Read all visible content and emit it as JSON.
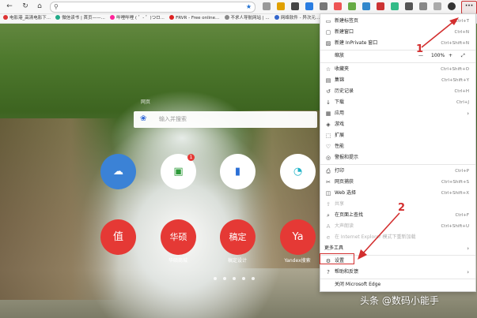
{
  "toolbar": {
    "back_icon": "back-arrow-icon",
    "refresh_icon": "refresh-icon",
    "home_icon": "home-icon",
    "more_label": "···"
  },
  "favorites": [
    {
      "label": "电影港_高清电影下...",
      "color": "#d33"
    },
    {
      "label": "微信读书 | 首页——...",
      "color": "#2a8"
    },
    {
      "label": "哔哩哔哩 ( ゜- ゜)つロ...",
      "color": "#f29"
    },
    {
      "label": "FRVR - Free online...",
      "color": "#d22"
    },
    {
      "label": "不求人导航网站 | ...",
      "color": "#888"
    },
    {
      "label": "网络软件 - 异次元...",
      "color": "#36c"
    }
  ],
  "search": {
    "tab_label": "网页",
    "placeholder": "输入并搜索"
  },
  "tiles": [
    {
      "symbol": "☁",
      "label": "",
      "color": "#3b82d6"
    },
    {
      "symbol": "▣",
      "label": "",
      "color": "#ffffff",
      "badge": "1"
    },
    {
      "symbol": "▮",
      "label": "",
      "color": "#ffffff"
    },
    {
      "symbol": "◔",
      "label": "",
      "color": "#ffffff"
    },
    {
      "symbol": "值",
      "label": "",
      "color": "#e53935"
    },
    {
      "symbol": "华硕",
      "label": "华硕商城",
      "color": "#e53935"
    },
    {
      "symbol": "稿定",
      "label": "稿定设计",
      "color": "#e53935"
    },
    {
      "symbol": "Ya",
      "label": "Yandex搜索",
      "color": "#e53935"
    }
  ],
  "menu": {
    "items": [
      {
        "icon": "▭",
        "label": "新建标签页",
        "shortcut": "Ctrl+T"
      },
      {
        "icon": "▢",
        "label": "新建窗口",
        "shortcut": "Ctrl+N"
      },
      {
        "icon": "▨",
        "label": "新建 InPrivate 窗口",
        "shortcut": "Ctrl+Shift+N"
      },
      {
        "icon": "",
        "label": "缩放",
        "shortcut": ""
      },
      {
        "icon": "☆",
        "label": "收藏夹",
        "shortcut": "Ctrl+Shift+O"
      },
      {
        "icon": "▤",
        "label": "集锦",
        "shortcut": "Ctrl+Shift+Y"
      },
      {
        "icon": "↺",
        "label": "历史记录",
        "shortcut": "Ctrl+H"
      },
      {
        "icon": "↓",
        "label": "下载",
        "shortcut": "Ctrl+J"
      },
      {
        "icon": "▦",
        "label": "应用",
        "shortcut": "",
        "arrow": "›"
      },
      {
        "icon": "◈",
        "label": "游戏",
        "shortcut": ""
      },
      {
        "icon": "⬚",
        "label": "扩展",
        "shortcut": ""
      },
      {
        "icon": "♡",
        "label": "性能",
        "shortcut": ""
      },
      {
        "icon": "◎",
        "label": "警报和提示",
        "shortcut": ""
      },
      {
        "icon": "⎙",
        "label": "打印",
        "shortcut": "Ctrl+P"
      },
      {
        "icon": "✂",
        "label": "网页捕获",
        "shortcut": "Ctrl+Shift+S"
      },
      {
        "icon": "◫",
        "label": "Web 选择",
        "shortcut": "Ctrl+Shift+X"
      },
      {
        "icon": "⇪",
        "label": "共享",
        "shortcut": "",
        "disabled": true
      },
      {
        "icon": "⌕",
        "label": "在页面上查找",
        "shortcut": "Ctrl+F"
      },
      {
        "icon": "A",
        "label": "大声朗读",
        "shortcut": "Ctrl+Shift+U",
        "disabled": true
      },
      {
        "icon": "e",
        "label": "在 Internet Explorer 模式下重新加载",
        "shortcut": "",
        "disabled": true
      },
      {
        "icon": "",
        "label": "更多工具",
        "shortcut": "",
        "arrow": "›"
      },
      {
        "icon": "⚙",
        "label": "设置",
        "shortcut": ""
      },
      {
        "icon": "?",
        "label": "帮助和反馈",
        "shortcut": "",
        "arrow": "›"
      },
      {
        "icon": "",
        "label": "关闭 Microsoft Edge",
        "shortcut": ""
      }
    ],
    "zoom_minus": "—",
    "zoom_value": "100%",
    "zoom_plus": "+",
    "fullscreen_icon": "⤢"
  },
  "annotations": {
    "label1": "1",
    "label2": "2"
  },
  "watermark": "头条 @数码小能手",
  "colors": {
    "accent": "#d32f2f",
    "star": "#1e6fd0"
  }
}
